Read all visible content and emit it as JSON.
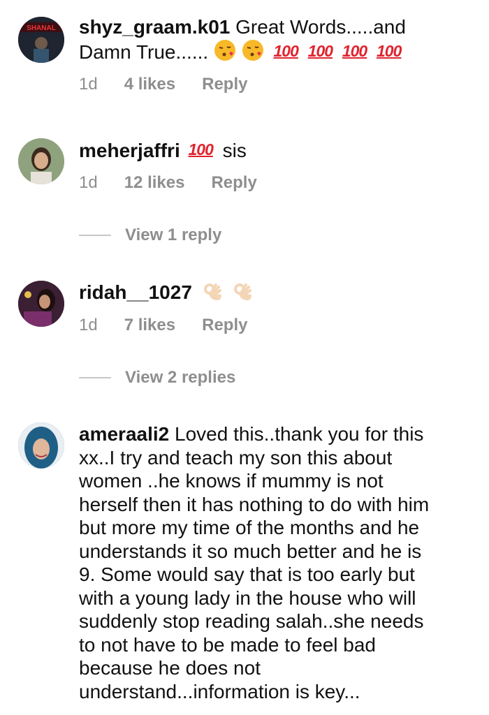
{
  "comments": [
    {
      "username": "shyz_graam.k01",
      "text_line1": "Great Words.....and",
      "text_line2": "Damn True......",
      "hundreds": [
        "100",
        "100",
        "100",
        "100"
      ],
      "time": "1d",
      "likes": "4 likes",
      "reply": "Reply"
    },
    {
      "username": "meherjaffri",
      "hundred": "100",
      "text": "sis",
      "time": "1d",
      "likes": "12 likes",
      "reply": "Reply",
      "view_replies": "View 1 reply"
    },
    {
      "username": "ridah__1027",
      "time": "1d",
      "likes": "7 likes",
      "reply": "Reply",
      "view_replies": "View 2 replies"
    },
    {
      "username": "ameraali2",
      "lines": [
        "Loved this..thank you for this",
        "xx..I try and teach my son this about",
        "women ..he knows if mummy is not",
        "herself then it has nothing to do with him",
        "but more my time of the months and he",
        "understands it so much better and he is",
        "9. Some would say that is too early but",
        "with a young lady in the house who will",
        "suddenly stop reading salah..she needs",
        "to not have to be made to feel bad",
        "because he does not",
        "understand...information is key..."
      ]
    }
  ]
}
